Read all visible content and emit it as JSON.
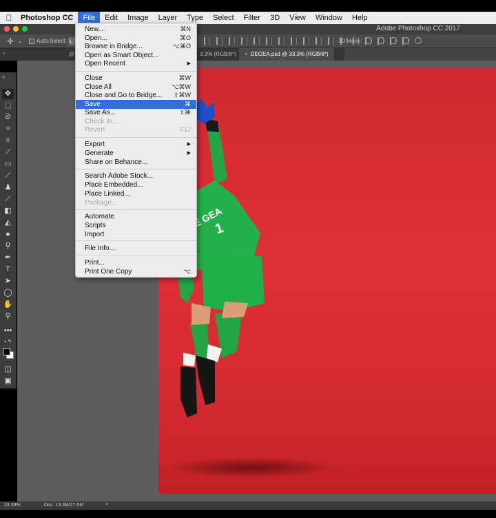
{
  "menubar": {
    "app_name": "Photoshop CC",
    "items": [
      "File",
      "Edit",
      "Image",
      "Layer",
      "Type",
      "Select",
      "Filter",
      "3D",
      "View",
      "Window",
      "Help"
    ]
  },
  "window": {
    "title": "Adobe Photoshop CC 2017"
  },
  "options": {
    "auto_select": "Auto-Select:",
    "layer_value": "L",
    "mode_3d": "3D Mode:"
  },
  "tabs": {
    "inactive": "3.3% (RGB/8*)",
    "active": "DEGEA.psd @ 33.3% (RGB/8*)",
    "close": "×",
    "at": "@"
  },
  "file_menu": {
    "items": [
      {
        "label": "New...",
        "shortcut": "⌘N"
      },
      {
        "label": "Open...",
        "shortcut": "⌘O"
      },
      {
        "label": "Browse in Bridge...",
        "shortcut": "⌥⌘O"
      },
      {
        "label": "Open as Smart Object...",
        "shortcut": ""
      },
      {
        "label": "Open Recent",
        "shortcut": "▶"
      },
      {
        "label": "Close",
        "shortcut": "⌘W"
      },
      {
        "label": "Close All",
        "shortcut": "⌥⌘W"
      },
      {
        "label": "Close and Go to Bridge...",
        "shortcut": "⇧⌘W"
      },
      {
        "label": "Save",
        "shortcut": "⌘"
      },
      {
        "label": "Save As...",
        "shortcut": "⇧⌘"
      },
      {
        "label": "Check In...",
        "shortcut": ""
      },
      {
        "label": "Revert",
        "shortcut": "F12"
      },
      {
        "label": "Export",
        "shortcut": "▶"
      },
      {
        "label": "Generate",
        "shortcut": "▶"
      },
      {
        "label": "Share on Behance...",
        "shortcut": ""
      },
      {
        "label": "Search Adobe Stock...",
        "shortcut": ""
      },
      {
        "label": "Place Embedded...",
        "shortcut": ""
      },
      {
        "label": "Place Linked...",
        "shortcut": ""
      },
      {
        "label": "Package...",
        "shortcut": ""
      },
      {
        "label": "Automate",
        "shortcut": ""
      },
      {
        "label": "Scripts",
        "shortcut": ""
      },
      {
        "label": "Import",
        "shortcut": ""
      },
      {
        "label": "File Info...",
        "shortcut": ""
      },
      {
        "label": "Print...",
        "shortcut": ""
      },
      {
        "label": "Print One Copy",
        "shortcut": "⌥"
      }
    ]
  },
  "jersey": {
    "name": "DE GEA",
    "number": "1"
  },
  "status": {
    "zoom": "33.33%",
    "doc": "Doc: 19.3M/17.5M",
    "arrow": ">"
  },
  "colors": {
    "canvas_red": "#d12931",
    "menu_highlight": "#2f6fd6",
    "jersey_green": "#22b04b"
  }
}
